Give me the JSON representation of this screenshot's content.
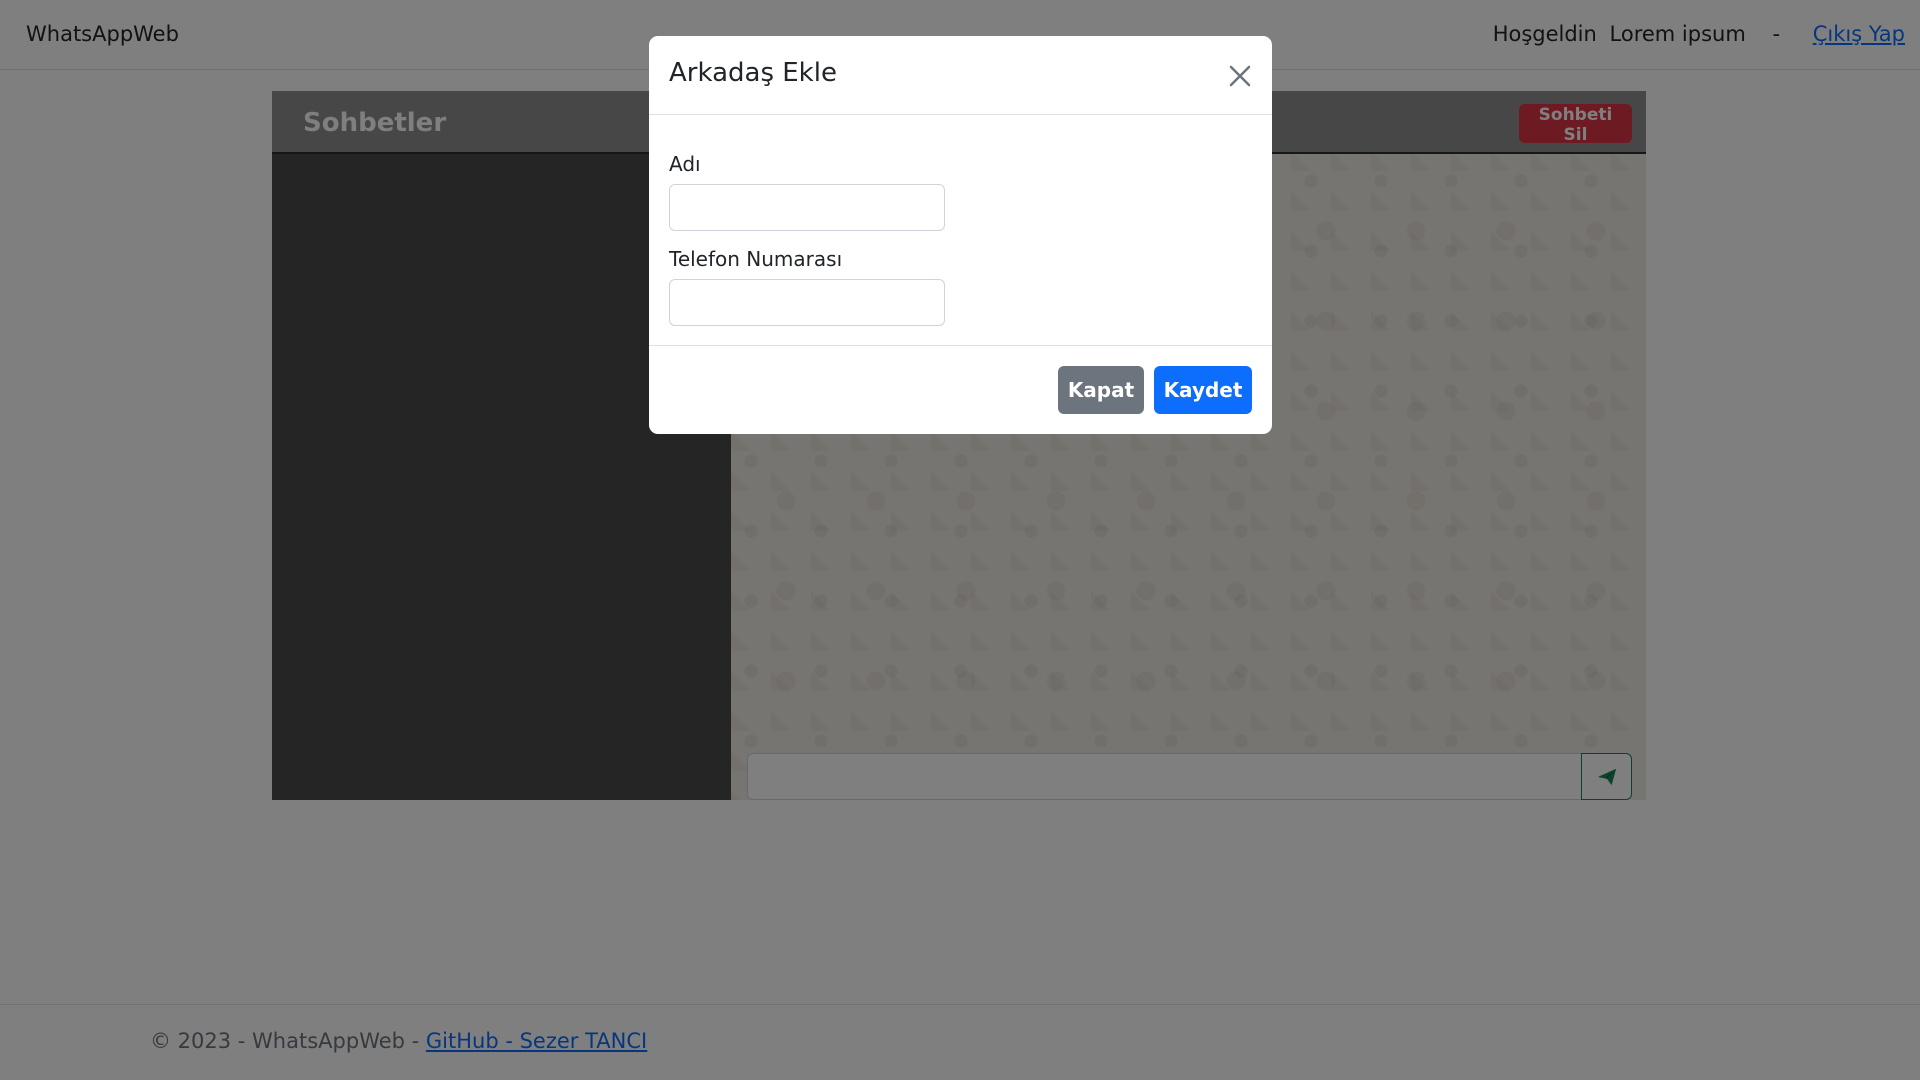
{
  "navbar": {
    "brand": "WhatsAppWeb",
    "greeting": "Hoşgeldin",
    "user_name": "Lorem ipsum",
    "separator": "-",
    "logout": "Çıkış Yap"
  },
  "sidebar": {
    "title": "Sohbetler"
  },
  "chat": {
    "delete_button": "Sohbeti Sil",
    "message_placeholder": "",
    "send_icon": "paper-plane-icon"
  },
  "modal": {
    "title": "Arkadaş Ekle",
    "close_icon": "close-icon",
    "fields": [
      {
        "label": "Adı",
        "value": ""
      },
      {
        "label": "Telefon Numarası",
        "value": ""
      }
    ],
    "close_button": "Kapat",
    "save_button": "Kaydet"
  },
  "footer": {
    "text": "© 2023 - WhatsAppWeb - ",
    "link": "GitHub - Sezer TANCI"
  },
  "colors": {
    "primary": "#0d6efd",
    "secondary": "#6c757d",
    "danger": "#dc3545",
    "success": "#198754",
    "sidebar": "#4a4a4a"
  }
}
